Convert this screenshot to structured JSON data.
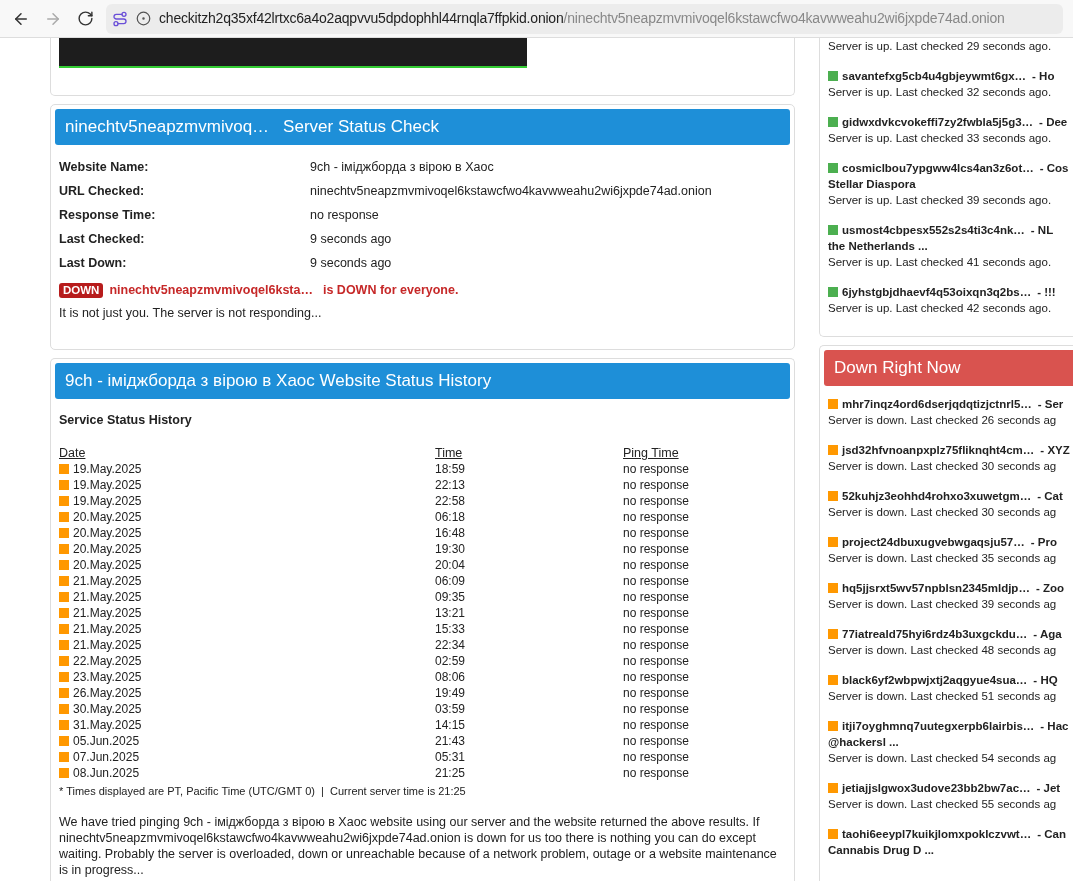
{
  "browser": {
    "back_disabled": false,
    "forward_disabled": true,
    "url_host": "checkitzh2q35xf42lrtxc6a4o2aqpvvu5dpdophhl44rnqla7ffpkid.onion",
    "url_path": "/ninechtv5neapzmvmivoqel6kstawcfwo4kavwweahu2wi6jxpde74ad.onion"
  },
  "status_card": {
    "title_name": "ninechtv5neapzmvmivoq…",
    "title": "Server Status Check",
    "fields": [
      {
        "label": "Website Name:",
        "value": "9ch - іміджборда з вірою в Хаос"
      },
      {
        "label": "URL Checked:",
        "value": "ninechtv5neapzmvmivoqel6kstawcfwo4kavwweahu2wi6jxpde74ad.onion"
      },
      {
        "label": "Response Time:",
        "value": "no response"
      },
      {
        "label": "Last Checked:",
        "value": "9 seconds ago"
      },
      {
        "label": "Last Down:",
        "value": "9 seconds ago"
      }
    ],
    "badge": "DOWN",
    "status_name": "ninechtv5neapzmvmivoqel6ksta…",
    "status_text": "is DOWN for everyone.",
    "note": "It is not just you. The server is not responding..."
  },
  "history": {
    "title": "9ch - іміджборда з вірою в Хаос Website Status History",
    "subtitle": "Service Status History",
    "columns": [
      "Date",
      "Time",
      "Ping Time"
    ],
    "rows": [
      [
        "19.May.2025",
        "18:59",
        "no response"
      ],
      [
        "19.May.2025",
        "22:13",
        "no response"
      ],
      [
        "19.May.2025",
        "22:58",
        "no response"
      ],
      [
        "20.May.2025",
        "06:18",
        "no response"
      ],
      [
        "20.May.2025",
        "16:48",
        "no response"
      ],
      [
        "20.May.2025",
        "19:30",
        "no response"
      ],
      [
        "20.May.2025",
        "20:04",
        "no response"
      ],
      [
        "21.May.2025",
        "06:09",
        "no response"
      ],
      [
        "21.May.2025",
        "09:35",
        "no response"
      ],
      [
        "21.May.2025",
        "13:21",
        "no response"
      ],
      [
        "21.May.2025",
        "15:33",
        "no response"
      ],
      [
        "21.May.2025",
        "22:34",
        "no response"
      ],
      [
        "22.May.2025",
        "02:59",
        "no response"
      ],
      [
        "23.May.2025",
        "08:06",
        "no response"
      ],
      [
        "26.May.2025",
        "19:49",
        "no response"
      ],
      [
        "30.May.2025",
        "03:59",
        "no response"
      ],
      [
        "31.May.2025",
        "14:15",
        "no response"
      ],
      [
        "05.Jun.2025",
        "21:43",
        "no response"
      ],
      [
        "07.Jun.2025",
        "05:31",
        "no response"
      ],
      [
        "08.Jun.2025",
        "21:25",
        "no response"
      ]
    ],
    "footnote": "* Times displayed are PT, Pacific Time (UTC/GMT 0)  |  Current server time is 21:25",
    "paragraph": "We have tried pinging 9ch - іміджборда з вірою в Хаос website using our server and the website returned the above results. If ninechtv5neapzmvmivoqel6kstawcfwo4kavwweahu2wi6jxpde74ad.onion is down for us too there is nothing you can do except waiting. Probably the server is overloaded, down or unreachable because of a network problem, outage or a website maintenance is in progress..."
  },
  "up_list": {
    "top_status": "Server is up. Last checked 29 seconds ago.",
    "items": [
      {
        "color": "#4caf50",
        "name": "savantefxg5cb4u4gbjeywmt6gx…",
        "desc": "- Ho",
        "status_text": "Server is up. Last checked 32 seconds ago."
      },
      {
        "color": "#4caf50",
        "name": "gidwxdvkcvokeffi7zy2fwbla5j5g3…",
        "desc": "- Dee",
        "status_text": "Server is up. Last checked 33 seconds ago."
      },
      {
        "color": "#4caf50",
        "name": "cosmiclbou7ypgww4lcs4an3z6ot…",
        "desc": "- Cos",
        "desc2": "Stellar Diaspora",
        "status_text": "Server is up. Last checked 39 seconds ago."
      },
      {
        "color": "#4caf50",
        "name": "usmost4cbpesx552s2s4ti3c4nk…",
        "desc": "- NL",
        "desc2": "the Netherlands ...",
        "status_text": "Server is up. Last checked 41 seconds ago."
      },
      {
        "color": "#4caf50",
        "name": "6jyhstgbjdhaevf4q53oixqn3q2bs…",
        "desc": "- !!!",
        "status_text": "Server is up. Last checked 42 seconds ago."
      }
    ]
  },
  "down_list": {
    "title": "Down Right Now",
    "items": [
      {
        "color": "#ff9800",
        "name": "mhr7inqz4ord6dserjqdqtizjctnrl5…",
        "desc": "- Ser",
        "status_text": "Server is down. Last checked 26 seconds ag"
      },
      {
        "color": "#ff9800",
        "name": "jsd32hfvnoanpxplz75fliknqht4cm…",
        "desc": "- XYZ",
        "status_text": "Server is down. Last checked 30 seconds ag"
      },
      {
        "color": "#ff9800",
        "name": "52kuhjz3eohhd4rohxo3xuwetgm…",
        "desc": "- Cat",
        "status_text": "Server is down. Last checked 30 seconds ag"
      },
      {
        "color": "#ff9800",
        "name": "project24dbuxugvebwgaqsju57…",
        "desc": "- Pro",
        "status_text": "Server is down. Last checked 35 seconds ag"
      },
      {
        "color": "#ff9800",
        "name": "hq5jjsrxt5wv57npblsn2345mldjp…",
        "desc": "- Zoo",
        "status_text": "Server is down. Last checked 39 seconds ag"
      },
      {
        "color": "#ff9800",
        "name": "77iatreald75hyi6rdz4b3uxgckdu…",
        "desc": "- Aga",
        "status_text": "Server is down. Last checked 48 seconds ag"
      },
      {
        "color": "#ff9800",
        "name": "black6yf2wbpwjxtj2aqgyue4sua…",
        "desc": "- HQ",
        "status_text": "Server is down. Last checked 51 seconds ag"
      },
      {
        "color": "#ff9800",
        "name": "itji7oyghmnq7uutegxerpb6lairbis…",
        "desc": "- Hac",
        "desc2": "@hackersl ...",
        "status_text": "Server is down. Last checked 54 seconds ag"
      },
      {
        "color": "#ff9800",
        "name": "jetiajjslgwox3udove23bb2bw7ac…",
        "desc": "- Jet",
        "status_text": "Server is down. Last checked 55 seconds ag"
      },
      {
        "color": "#ff9800",
        "name": "taohi6eeypl7kuikjlomxpoklczvwt…",
        "desc": "- Can",
        "desc2": "Cannabis Drug D ..."
      }
    ]
  }
}
